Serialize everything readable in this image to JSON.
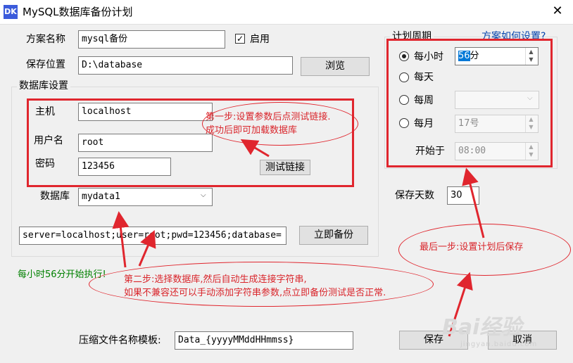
{
  "window": {
    "title": "MySQL数据库备份计划",
    "icon_text": "DK",
    "close_glyph": "✕"
  },
  "plan": {
    "name_label": "方案名称",
    "name_value": "mysql备份",
    "enable_label": "启用",
    "enabled": true
  },
  "save_path": {
    "label": "保存位置",
    "value": "D:\\database",
    "browse_label": "浏览"
  },
  "db_settings": {
    "legend": "数据库设置",
    "host_label": "主机",
    "host_value": "localhost",
    "user_label": "用户名",
    "user_value": "root",
    "password_label": "密码",
    "password_value": "123456",
    "test_button_label": "测试链接",
    "database_label": "数据库",
    "database_value": "mydata1"
  },
  "connection_string": "server=localhost;user=root;pwd=123456;database=",
  "backup_now_label": "立即备份",
  "status_text": "每小时56分开始执行!",
  "schedule": {
    "legend": "计划周期",
    "help_link": "方案如何设置?",
    "hourly_label": "每小时",
    "hourly_value_num": "56",
    "hourly_value_unit": "分",
    "daily_label": "每天",
    "weekly_label": "每周",
    "monthly_label": "每月",
    "monthly_value": "17号",
    "start_label": "开始于",
    "start_value": "08:00",
    "selected": "hourly"
  },
  "keep_days": {
    "label": "保存天数",
    "value": "30"
  },
  "template": {
    "label": "压缩文件名称模板:",
    "value": "Data_{yyyyMMddHHmmss}"
  },
  "buttons": {
    "save_label": "保存",
    "cancel_label": "取消"
  },
  "annotations": {
    "step1_line1": "第一步:设置参数后点测试链接.",
    "step1_line2": "成功后即可加载数据库",
    "step2_line1": "第二步:选择数据库,然后自动生成连接字符串,",
    "step2_line2": "如果不兼容还可以手动添加字符串参数,点立即备份测试是否正常.",
    "step3": "最后一步:设置计划后保存"
  },
  "watermark": {
    "main": "Bai经验",
    "sub": "jingyan.baidu.com"
  },
  "colors": {
    "annotation_red": "#e0262e",
    "status_green": "#008000",
    "link_blue": "#0645ad"
  }
}
